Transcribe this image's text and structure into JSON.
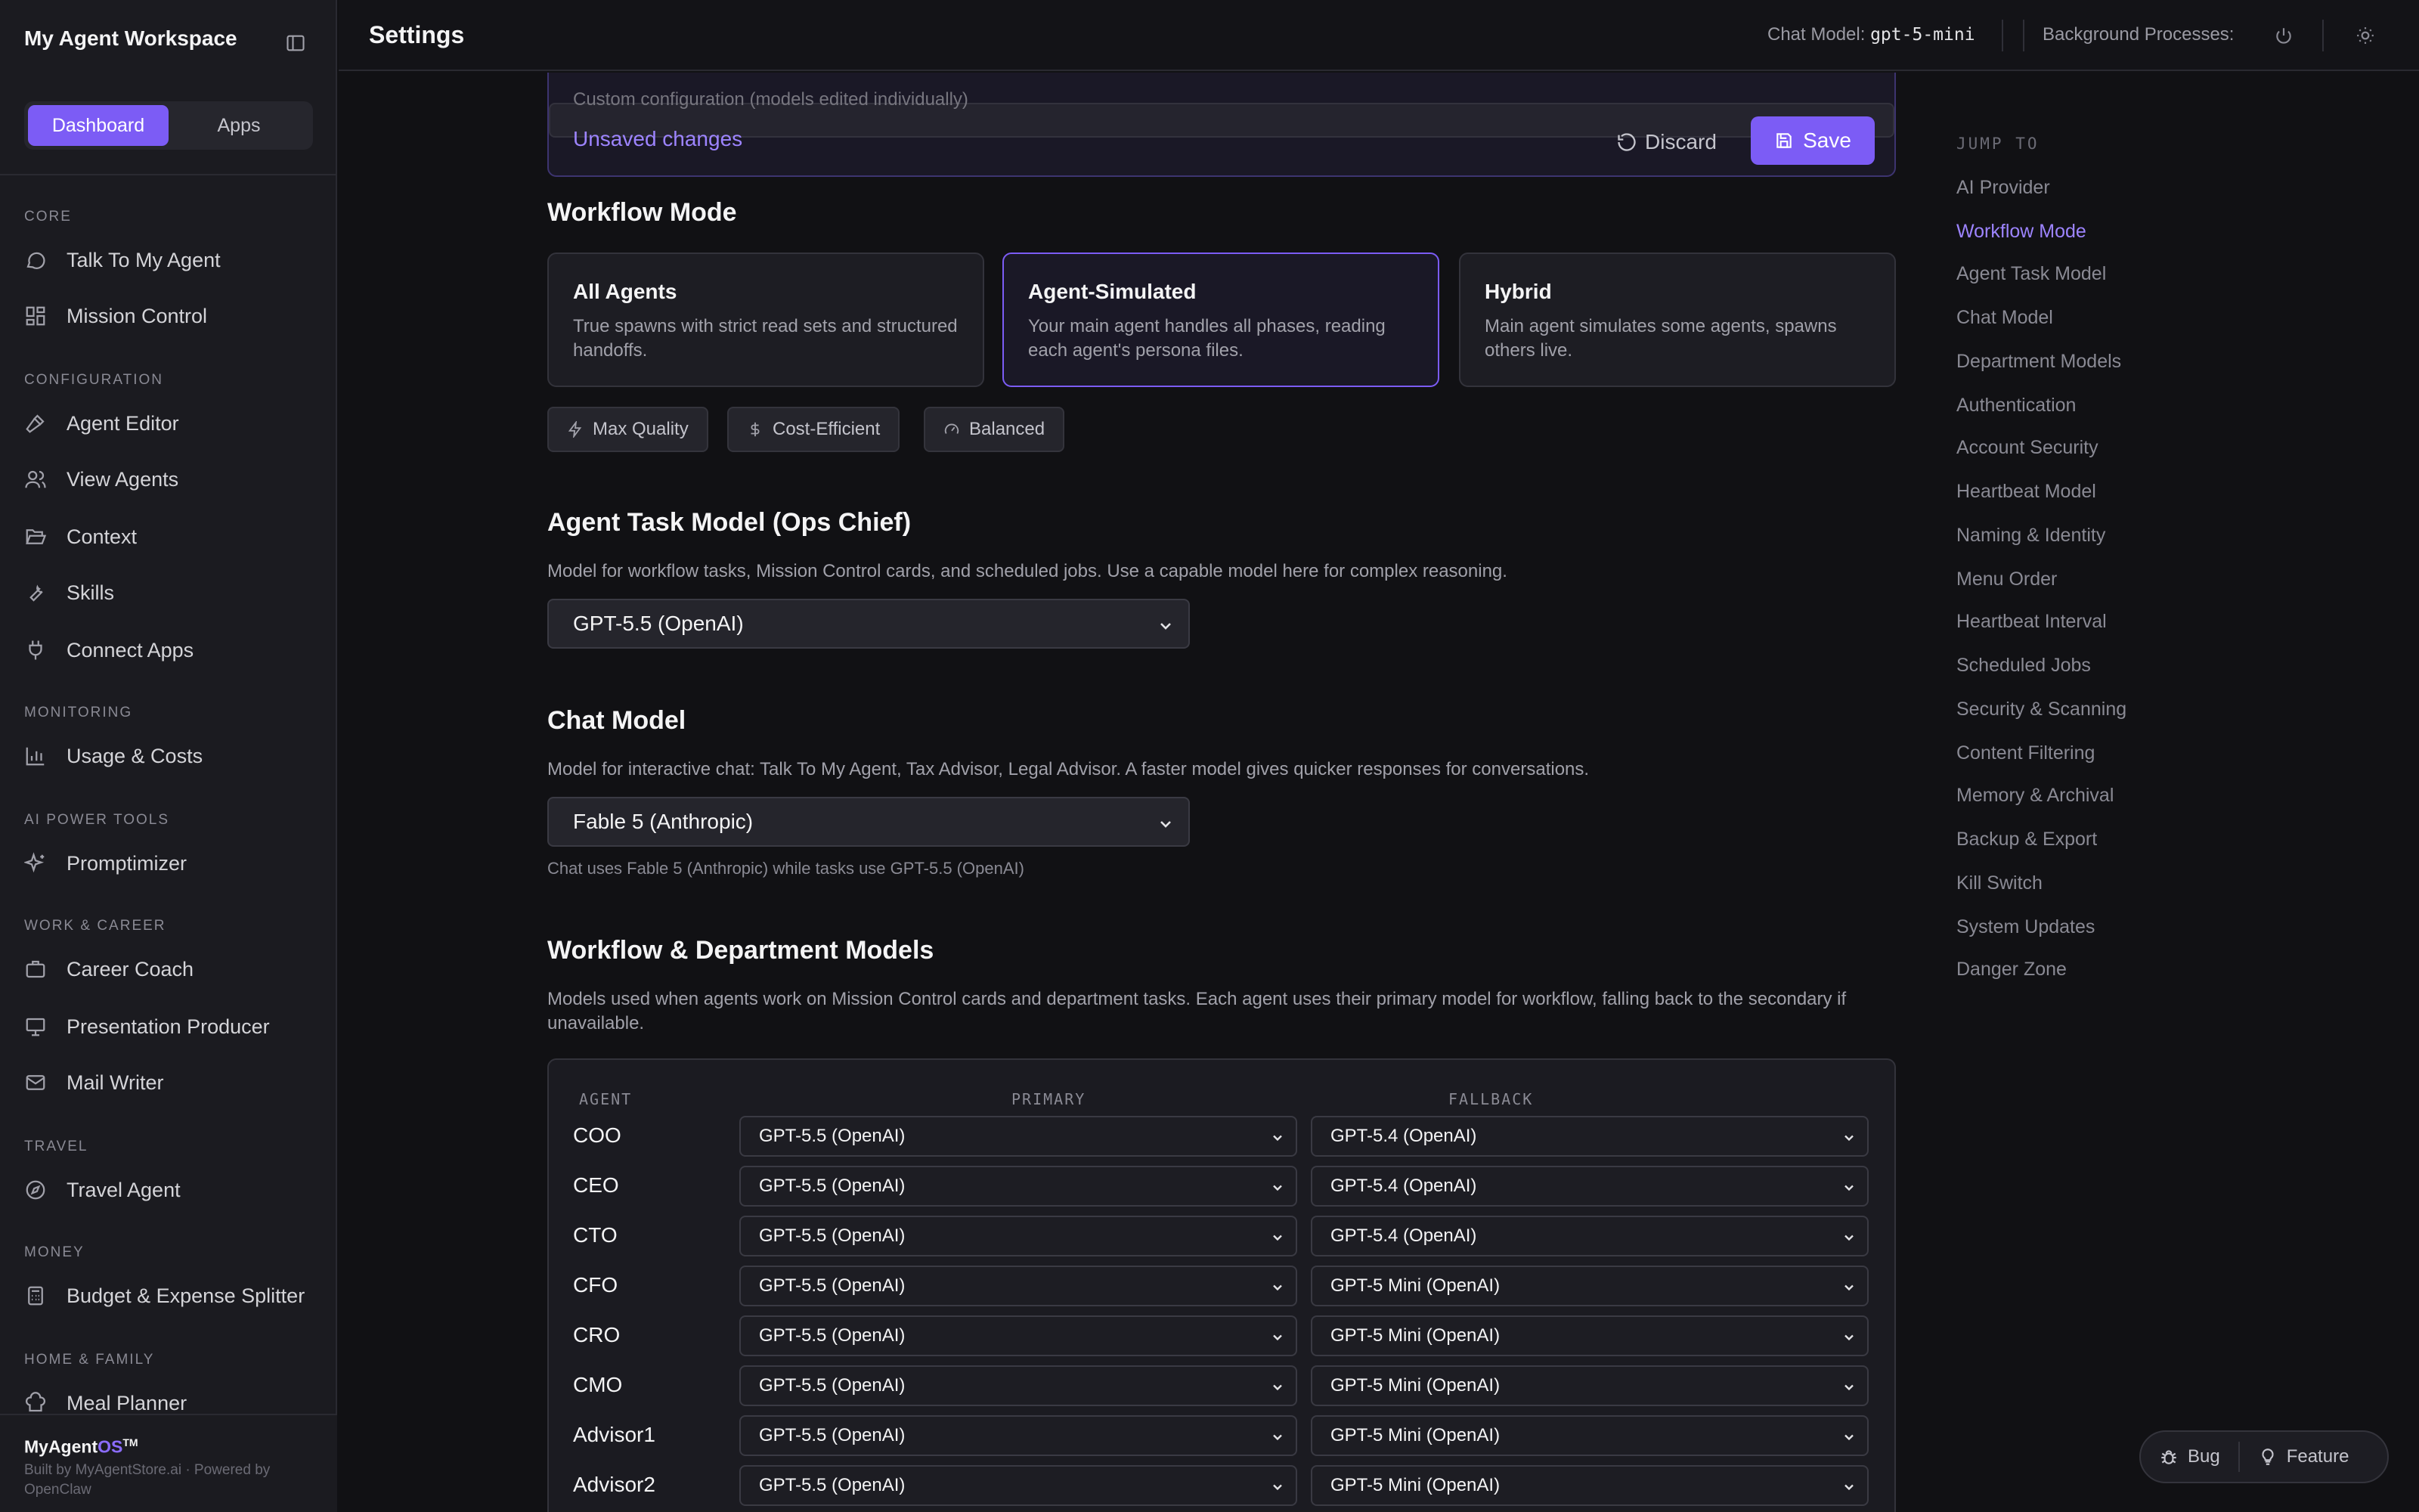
{
  "sidebar": {
    "workspace_title": "My Agent Workspace",
    "tabs": [
      {
        "label": "Dashboard",
        "active": true
      },
      {
        "label": "Apps",
        "active": false
      }
    ],
    "sections": [
      {
        "label": "CORE",
        "items": [
          "Talk To My Agent",
          "Mission Control"
        ]
      },
      {
        "label": "CONFIGURATION",
        "items": [
          "Agent Editor",
          "View Agents",
          "Context",
          "Skills",
          "Connect Apps"
        ]
      },
      {
        "label": "MONITORING",
        "items": [
          "Usage & Costs"
        ]
      },
      {
        "label": "AI POWER TOOLS",
        "items": [
          "Promptimizer"
        ]
      },
      {
        "label": "WORK & CAREER",
        "items": [
          "Career Coach",
          "Presentation Producer",
          "Mail Writer"
        ]
      },
      {
        "label": "TRAVEL",
        "items": [
          "Travel Agent"
        ]
      },
      {
        "label": "MONEY",
        "items": [
          "Budget & Expense Splitter"
        ]
      },
      {
        "label": "HOME & FAMILY",
        "items": [
          "Meal Planner"
        ]
      }
    ],
    "footer": {
      "brand_prefix": "MyAgent",
      "brand_os": "OS",
      "brand_tm": "TM",
      "built_by": "Built by MyAgentStore.ai · Powered by OpenClaw"
    }
  },
  "topbar": {
    "title": "Settings",
    "chat_model_label": "Chat Model:",
    "chat_model_value": "gpt-5-mini",
    "background_label": "Background Processes:"
  },
  "unsaved": {
    "faded_text": "Custom configuration (models edited individually)",
    "message": "Unsaved changes",
    "discard_label": "Discard",
    "save_label": "Save"
  },
  "workflow_mode": {
    "title": "Workflow Mode",
    "cards": [
      {
        "title": "All Agents",
        "desc": "True spawns with strict read sets and structured handoffs.",
        "selected": false
      },
      {
        "title": "Agent-Simulated",
        "desc": "Your main agent handles all phases, reading each agent's persona files.",
        "selected": true
      },
      {
        "title": "Hybrid",
        "desc": "Main agent simulates some agents, spawns others live.",
        "selected": false
      }
    ],
    "presets": [
      "Max Quality",
      "Cost-Efficient",
      "Balanced"
    ]
  },
  "agent_task_model": {
    "title": "Agent Task Model (Ops Chief)",
    "desc": "Model for workflow tasks, Mission Control cards, and scheduled jobs. Use a capable model here for complex reasoning.",
    "selected": "GPT-5.5 (OpenAI)"
  },
  "chat_model": {
    "title": "Chat Model",
    "desc": "Model for interactive chat: Talk To My Agent, Tax Advisor, Legal Advisor. A faster model gives quicker responses for conversations.",
    "selected": "Fable 5 (Anthropic)",
    "note": "Chat uses Fable 5 (Anthropic) while tasks use GPT-5.5 (OpenAI)"
  },
  "department_models": {
    "title": "Workflow & Department Models",
    "desc": "Models used when agents work on Mission Control cards and department tasks. Each agent uses their primary model for workflow, falling back to the secondary if unavailable.",
    "headers": {
      "agent": "AGENT",
      "primary": "PRIMARY",
      "fallback": "FALLBACK"
    },
    "rows": [
      {
        "agent": "COO",
        "primary": "GPT-5.5 (OpenAI)",
        "fallback": "GPT-5.4 (OpenAI)"
      },
      {
        "agent": "CEO",
        "primary": "GPT-5.5 (OpenAI)",
        "fallback": "GPT-5.4 (OpenAI)"
      },
      {
        "agent": "CTO",
        "primary": "GPT-5.5 (OpenAI)",
        "fallback": "GPT-5.4 (OpenAI)"
      },
      {
        "agent": "CFO",
        "primary": "GPT-5.5 (OpenAI)",
        "fallback": "GPT-5 Mini (OpenAI)"
      },
      {
        "agent": "CRO",
        "primary": "GPT-5.5 (OpenAI)",
        "fallback": "GPT-5 Mini (OpenAI)"
      },
      {
        "agent": "CMO",
        "primary": "GPT-5.5 (OpenAI)",
        "fallback": "GPT-5 Mini (OpenAI)"
      },
      {
        "agent": "Advisor1",
        "primary": "GPT-5.5 (OpenAI)",
        "fallback": "GPT-5 Mini (OpenAI)"
      },
      {
        "agent": "Advisor2",
        "primary": "GPT-5.5 (OpenAI)",
        "fallback": "GPT-5 Mini (OpenAI)"
      }
    ]
  },
  "jump_to": {
    "title": "JUMP TO",
    "active": "Workflow Mode",
    "items": [
      "AI Provider",
      "Workflow Mode",
      "Agent Task Model",
      "Chat Model",
      "Department Models",
      "Authentication",
      "Account Security",
      "Heartbeat Model",
      "Naming & Identity",
      "Menu Order",
      "Heartbeat Interval",
      "Scheduled Jobs",
      "Security & Scanning",
      "Content Filtering",
      "Memory & Archival",
      "Backup & Export",
      "Kill Switch",
      "System Updates",
      "Danger Zone"
    ]
  },
  "feedback": {
    "bug_label": "Bug",
    "feature_label": "Feature"
  },
  "colors": {
    "accent": "#7c5cf5",
    "accent_text": "#9d84ff",
    "background": "#111114",
    "sidebar": "#1b1b20"
  }
}
